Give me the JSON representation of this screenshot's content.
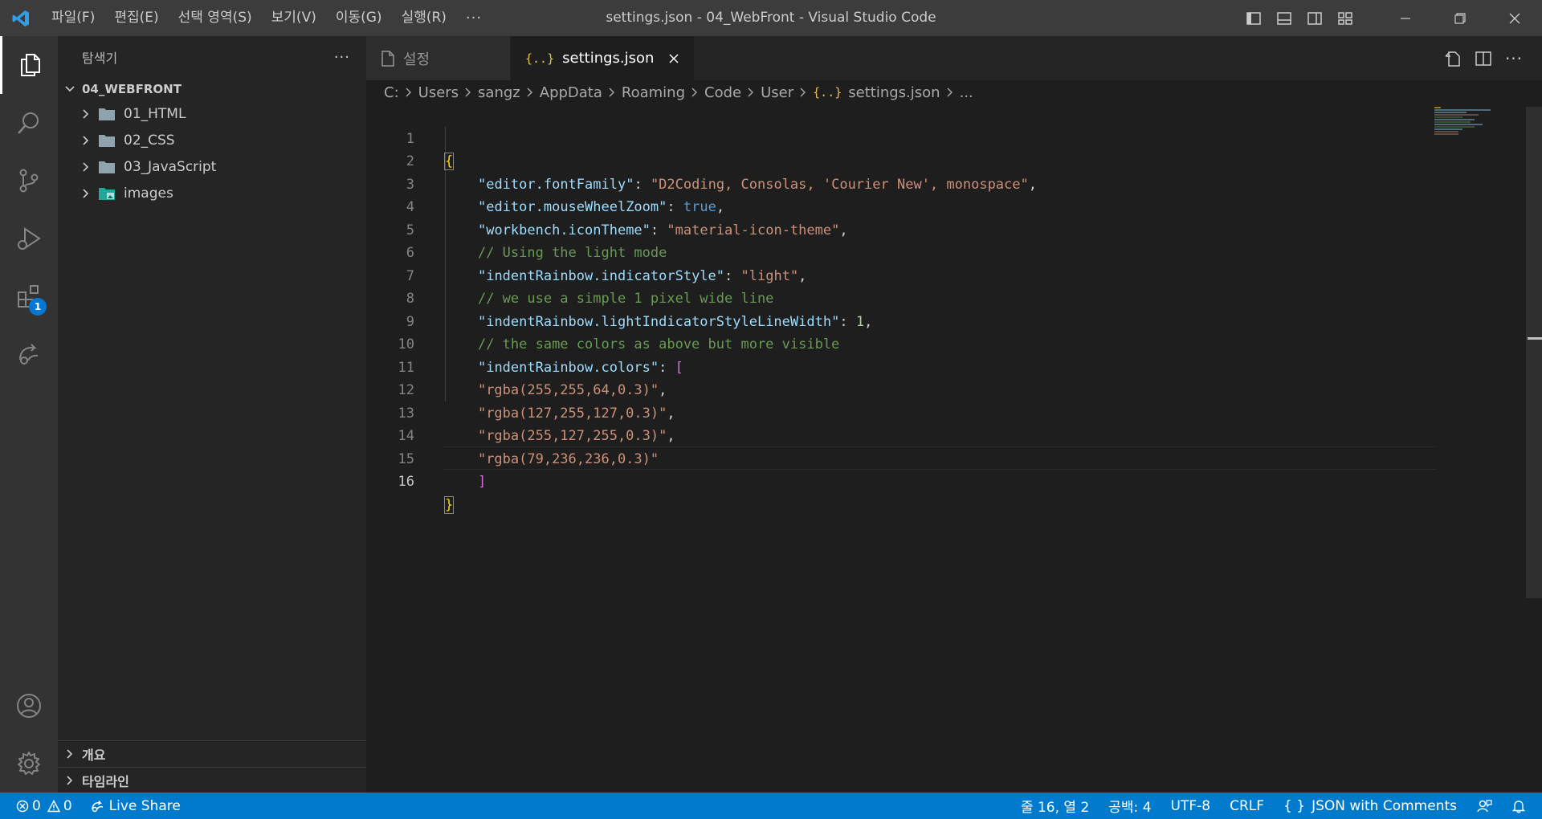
{
  "window": {
    "title": "settings.json - 04_WebFront - Visual Studio Code",
    "menu": [
      "파일(F)",
      "편집(E)",
      "선택 영역(S)",
      "보기(V)",
      "이동(G)",
      "실행(R)"
    ],
    "menu_more": "···"
  },
  "activity": {
    "extensions_badge": "1"
  },
  "sidebar": {
    "title": "탐색기",
    "more": "···",
    "root_folder": "04_WEBFRONT",
    "items": [
      {
        "label": "01_HTML"
      },
      {
        "label": "02_CSS"
      },
      {
        "label": "03_JavaScript"
      },
      {
        "label": "images"
      }
    ],
    "sections": [
      {
        "label": "개요"
      },
      {
        "label": "타임라인"
      }
    ]
  },
  "tabs": [
    {
      "label": "설정",
      "active": false
    },
    {
      "label": "settings.json",
      "active": true
    }
  ],
  "breadcrumb": [
    "C:",
    "Users",
    "sangz",
    "AppData",
    "Roaming",
    "Code",
    "User",
    "settings.json",
    "..."
  ],
  "editor": {
    "line_numbers": [
      "1",
      "2",
      "3",
      "4",
      "5",
      "6",
      "7",
      "8",
      "9",
      "10",
      "11",
      "12",
      "13",
      "14",
      "15",
      "16"
    ],
    "lines": [
      {
        "key": "editor.fontFamily",
        "value": "\"D2Coding, Consolas, 'Courier New', monospace\""
      },
      {
        "key": "editor.mouseWheelZoom",
        "value": "true"
      },
      {
        "key": "workbench.iconTheme",
        "value": "\"material-icon-theme\""
      },
      {
        "comment": "// Using the light mode"
      },
      {
        "key": "indentRainbow.indicatorStyle",
        "value": "\"light\""
      },
      {
        "comment": "// we use a simple 1 pixel wide line"
      },
      {
        "key": "indentRainbow.lightIndicatorStyleLineWidth",
        "value": "1"
      },
      {
        "comment": "// the same colors as above but more visible"
      },
      {
        "key": "indentRainbow.colors"
      },
      {
        "value": "\"rgba(255,255,64,0.3)\""
      },
      {
        "value": "\"rgba(127,255,127,0.3)\""
      },
      {
        "value": "\"rgba(255,127,255,0.3)\""
      },
      {
        "value": "\"rgba(79,236,236,0.3)\""
      }
    ],
    "open_brace": "{",
    "close_brace": "}",
    "open_bracket": "[",
    "close_bracket": "]"
  },
  "statusbar": {
    "errors": "0",
    "warnings": "0",
    "live_share": "Live Share",
    "position": "줄 16, 열 2",
    "indent": "공백: 4",
    "encoding": "UTF-8",
    "eol": "CRLF",
    "language": "JSON with Comments",
    "language_icon": "{ }"
  },
  "colors": {
    "statusbar": "#007acc",
    "activity_bar": "#333333",
    "sidebar": "#252526",
    "editor": "#1e1e1e",
    "title_bar": "#3c3c3c"
  }
}
